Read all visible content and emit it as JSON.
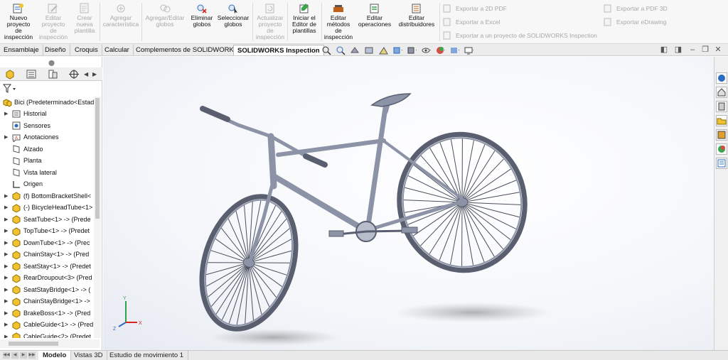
{
  "ribbon": {
    "buttons": [
      {
        "label": "Nuevo\nproyecto\nde\ninspección",
        "enabled": true,
        "icon": "new-project-icon"
      },
      {
        "label": "Editar\nproyecto\nde\ninspección",
        "enabled": false,
        "icon": "edit-project-icon"
      },
      {
        "label": "Crear\nnueva\nplantilla",
        "enabled": false,
        "icon": "new-template-icon"
      },
      {
        "label": "Agregar\ncaracterística",
        "enabled": false,
        "icon": "add-feature-icon"
      },
      {
        "label": "Agregar/Editar\nglobos",
        "enabled": false,
        "icon": "edit-balloons-icon"
      },
      {
        "label": "Eliminar\nglobos",
        "enabled": true,
        "icon": "delete-balloons-icon"
      },
      {
        "label": "Seleccionar\nglobos",
        "enabled": true,
        "icon": "select-balloons-icon"
      },
      {
        "label": "Actualizar\nproyecto\nde\ninspección",
        "enabled": false,
        "icon": "update-project-icon"
      },
      {
        "label": "Iniciar el\nEditor de\nplantillas",
        "enabled": true,
        "icon": "template-editor-icon"
      },
      {
        "label": "Editar\nmétodos\nde\ninspección",
        "enabled": true,
        "icon": "edit-methods-icon"
      },
      {
        "label": "Editar\noperaciones",
        "enabled": true,
        "icon": "edit-operations-icon"
      },
      {
        "label": "Editar\ndistribuidores",
        "enabled": true,
        "icon": "edit-distributors-icon"
      }
    ],
    "exports": [
      "Exportar a 2D PDF",
      "Exportar a Excel",
      "Exportar a un proyecto de SOLIDWORKS Inspection",
      "Exportar a PDF 3D",
      "Exportar eDrawing"
    ]
  },
  "command_tabs": [
    "Ensamblaje",
    "Diseño",
    "Croquis",
    "Calcular",
    "Complementos de SOLIDWORKS",
    "SOLIDWORKS Inspection"
  ],
  "active_command_tab": "SOLIDWORKS Inspection",
  "feature_tree": {
    "root": "Bici  (Predeterminado<Estad",
    "items": [
      {
        "label": "Historial",
        "icon": "history-icon",
        "expandable": true
      },
      {
        "label": "Sensores",
        "icon": "sensor-icon",
        "expandable": false
      },
      {
        "label": "Anotaciones",
        "icon": "annotations-icon",
        "expandable": true
      },
      {
        "label": "Alzado",
        "icon": "plane-icon",
        "expandable": false
      },
      {
        "label": "Planta",
        "icon": "plane-icon",
        "expandable": false
      },
      {
        "label": "Vista lateral",
        "icon": "plane-icon",
        "expandable": false
      },
      {
        "label": "Origen",
        "icon": "origin-icon",
        "expandable": false
      },
      {
        "label": "(f) BottomBracketShell<",
        "icon": "part-icon",
        "expandable": true
      },
      {
        "label": "(-) BicycleHeadTube<1>",
        "icon": "part-icon",
        "expandable": true
      },
      {
        "label": "SeatTube<1> -> (Prede",
        "icon": "part-icon",
        "expandable": true
      },
      {
        "label": "TopTube<1> -> (Predet",
        "icon": "part-icon",
        "expandable": true
      },
      {
        "label": "DownTube<1> -> (Prec",
        "icon": "part-icon",
        "expandable": true
      },
      {
        "label": "ChainStay<1> -> (Pred",
        "icon": "part-icon",
        "expandable": true
      },
      {
        "label": "SeatStay<1> -> (Predet",
        "icon": "part-icon",
        "expandable": true
      },
      {
        "label": "RearDroupout<3> (Pred",
        "icon": "part-icon",
        "expandable": true
      },
      {
        "label": "SeatStayBridge<1> -> (",
        "icon": "part-icon",
        "expandable": true
      },
      {
        "label": "ChainStayBridge<1> ->",
        "icon": "part-icon",
        "expandable": true
      },
      {
        "label": "BrakeBoss<1> -> (Pred",
        "icon": "part-icon",
        "expandable": true
      },
      {
        "label": "CableGuide<1> -> (Pred",
        "icon": "part-icon",
        "expandable": true
      },
      {
        "label": "CableGuide<2> (Predet",
        "icon": "part-icon",
        "expandable": true
      }
    ]
  },
  "bottom_tabs": [
    "Modelo",
    "Vistas 3D",
    "Estudio de movimiento 1"
  ],
  "active_bottom_tab": "Modelo",
  "triad": {
    "x": "X",
    "y": "Y",
    "z": "Z"
  },
  "colors": {
    "part_yellow": "#f2c230",
    "model_gray": "#8d93a6",
    "model_dark": "#5a5f70",
    "accent_blue": "#2a6cc0"
  }
}
